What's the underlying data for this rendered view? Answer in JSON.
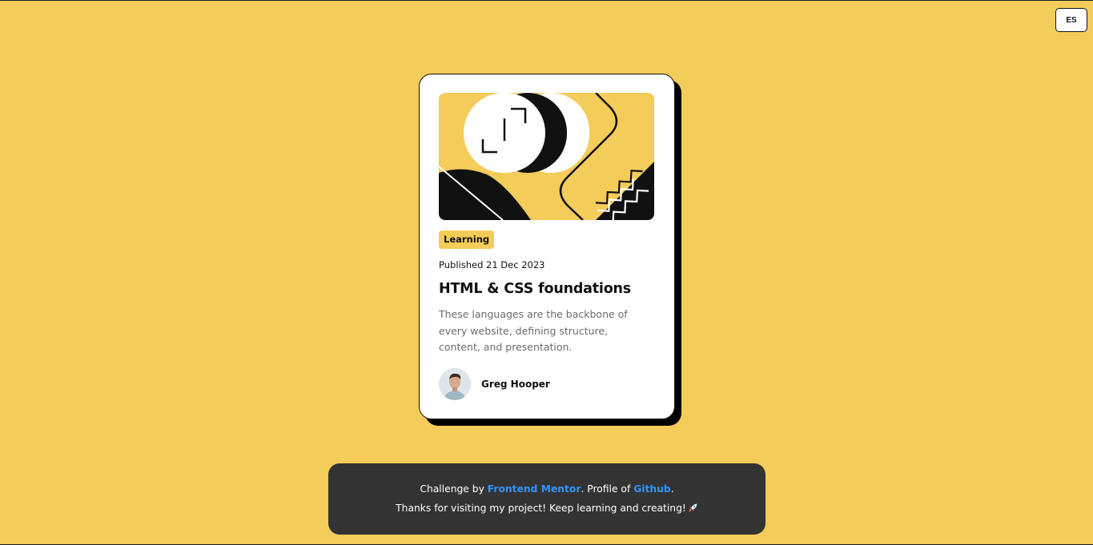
{
  "lang_button": {
    "label": "ES"
  },
  "card": {
    "tag": "Learning",
    "published": "Published 21 Dec 2023",
    "title": "HTML & CSS foundations",
    "description": "These languages are the backbone of every website, defining structure, content, and presentation.",
    "author": "Greg Hooper"
  },
  "footer": {
    "line1_prefix": "Challenge by ",
    "frontend_mentor_link": "Frontend Mentor",
    "line1_middle": ". Profile of ",
    "github_link": "Github",
    "line1_suffix": ".",
    "line2": "Thanks for visiting my project! Keep learning and creating!",
    "line2_icon": "rocket-icon"
  },
  "colors": {
    "background": "#f4cc5a",
    "card": "#ffffff",
    "footer": "#333333",
    "link": "#2f95ff"
  }
}
